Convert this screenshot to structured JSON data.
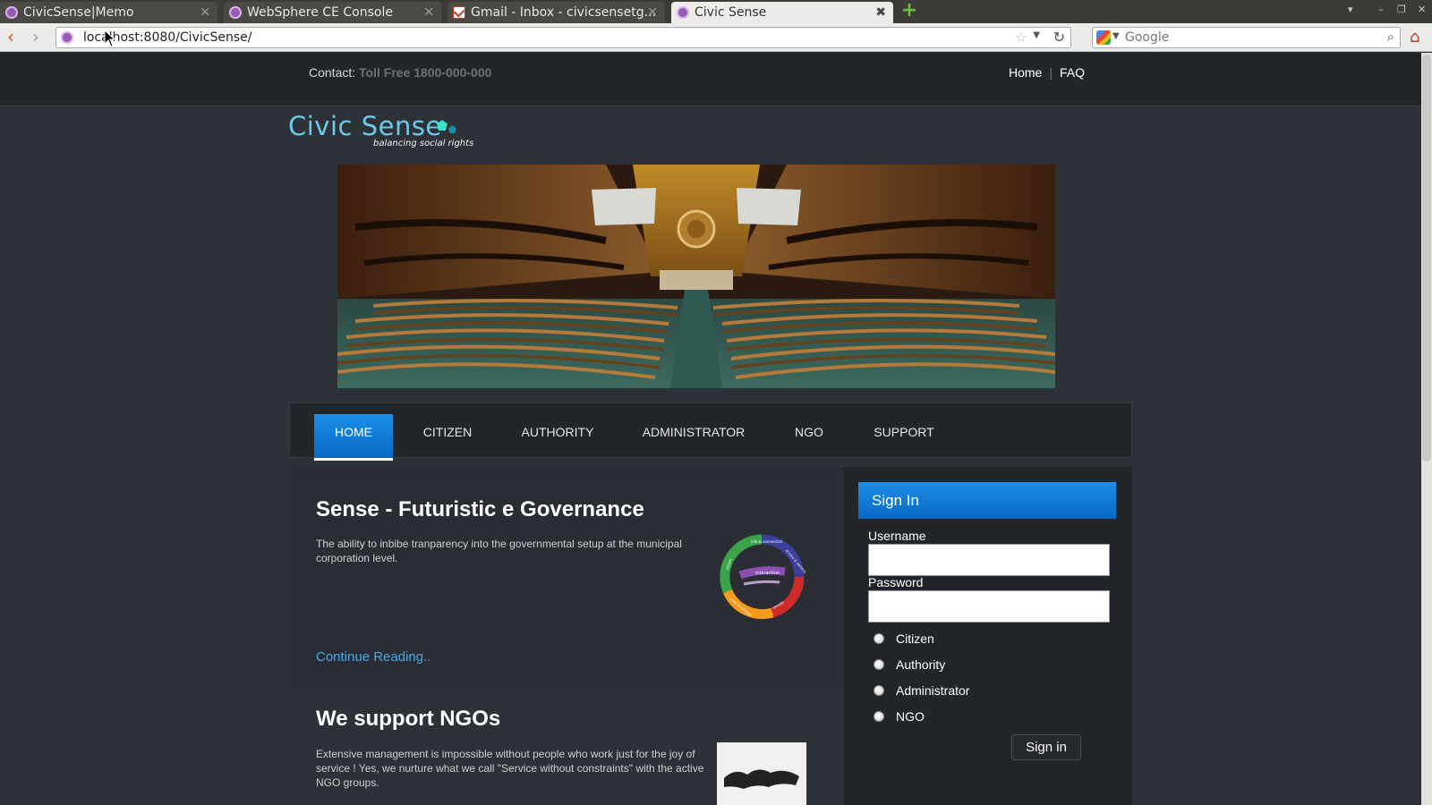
{
  "browser": {
    "tabs": [
      {
        "title": "CivicSense|Memo"
      },
      {
        "title": "WebSphere CE Console"
      },
      {
        "title": "Gmail - Inbox - civicsensetg..."
      },
      {
        "title": "Civic Sense"
      }
    ],
    "url": "localhost:8080/CivicSense/",
    "search_placeholder": "Google",
    "icons": {
      "back": "back-arrow-icon",
      "forward": "forward-arrow-icon",
      "new_tab": "plus-icon",
      "bookmark": "star-icon",
      "reload": "reload-icon",
      "search": "magnifier-icon",
      "home": "home-icon"
    }
  },
  "site": {
    "contact_label": "Contact:",
    "contact_phone": "Toll Free 1800-000-000",
    "top_links": [
      "Home",
      "FAQ"
    ],
    "logo_name": "Civic Sense",
    "logo_tagline": "balancing social rights",
    "menu": [
      "HOME",
      "CITIZEN",
      "AUTHORITY",
      "ADMINISTRATOR",
      "NGO",
      "SUPPORT"
    ],
    "active_menu": "HOME",
    "articles": [
      {
        "title": "Sense - Futuristic e Governance",
        "text": "The ability to inbibe tranparency into the governmental setup at the municipal corporation level.",
        "link": "Continue Reading..",
        "ring_labels": [
          "interaction",
          "info & connection",
          "access & service",
          "people",
          "core & content",
          "citizen"
        ]
      },
      {
        "title": "We support NGOs",
        "text": "Extensive management is impossible without people who work just for the joy of service ! Yes, we nurture what we call \"Service without constraints\" with the active NGO groups."
      }
    ],
    "signin": {
      "heading": "Sign In",
      "username_label": "Username",
      "password_label": "Password",
      "roles": [
        "Citizen",
        "Authority",
        "Administrator",
        "NGO"
      ],
      "button": "Sign in"
    },
    "colors": {
      "accent": "#0a7ad6",
      "link": "#4aa6e8",
      "background": "#2d3138",
      "topbar": "#22252a"
    }
  }
}
